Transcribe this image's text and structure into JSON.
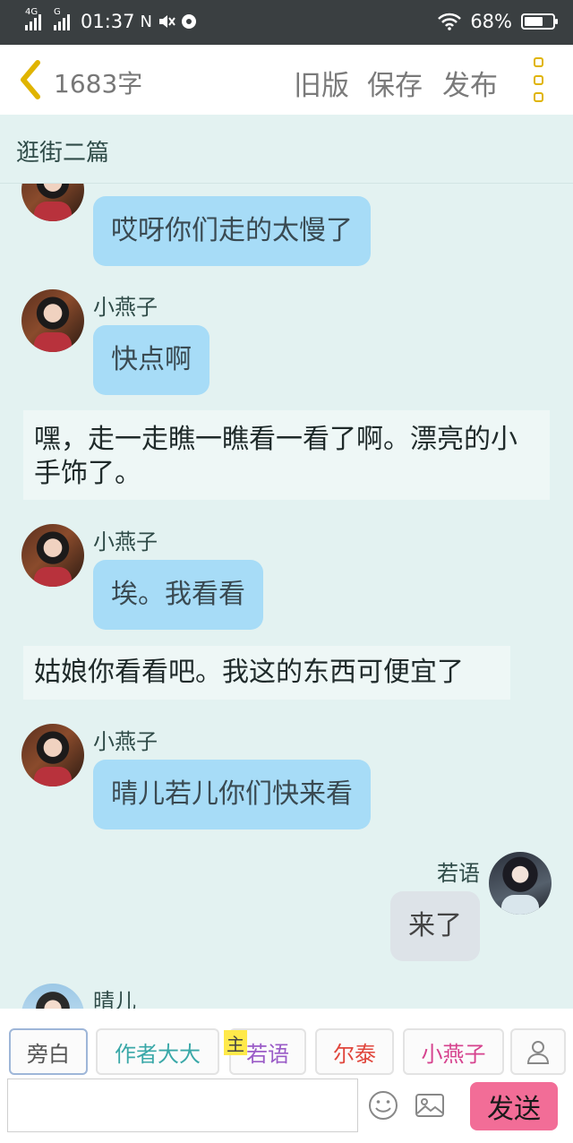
{
  "status_bar": {
    "network_left": "4G",
    "network_right": "G",
    "time": "01:37",
    "battery": "68%",
    "battery_level": 0.68
  },
  "header": {
    "word_count": "1683字",
    "buttons": [
      "旧版",
      "保存",
      "发布"
    ]
  },
  "chapter": {
    "title": "逛街二篇"
  },
  "messages": [
    {
      "speaker": "",
      "text": "哎呀你们走的太慢了"
    },
    {
      "speaker": "小燕子",
      "text": "快点啊"
    },
    {
      "narration": "嘿，走一走瞧一瞧看一看了啊。漂亮的小手饰了。"
    },
    {
      "speaker": "小燕子",
      "text": "埃。我看看"
    },
    {
      "narration": "姑娘你看看吧。我这的东西可便宜了"
    },
    {
      "speaker": "小燕子",
      "text": "晴儿若儿你们快来看"
    },
    {
      "speaker": "若语",
      "text": "来了"
    },
    {
      "speaker": "晴儿",
      "text": ""
    }
  ],
  "roles": [
    {
      "label": "旁白",
      "color": "#555555"
    },
    {
      "label": "作者大大",
      "color": "#3aa8a8"
    },
    {
      "label": "若语",
      "color": "#9a5bc7",
      "owner_tag": "主"
    },
    {
      "label": "尔泰",
      "color": "#e0463c"
    },
    {
      "label": "小燕子",
      "color": "#d6428e"
    }
  ],
  "composer": {
    "input_value": "",
    "input_placeholder": "",
    "send_label": "发送"
  },
  "icons": {
    "back": "chevron-left-icon",
    "more": "more-vertical-icon",
    "add_role": "person-icon",
    "emoji": "smiley-icon",
    "image": "image-icon"
  }
}
